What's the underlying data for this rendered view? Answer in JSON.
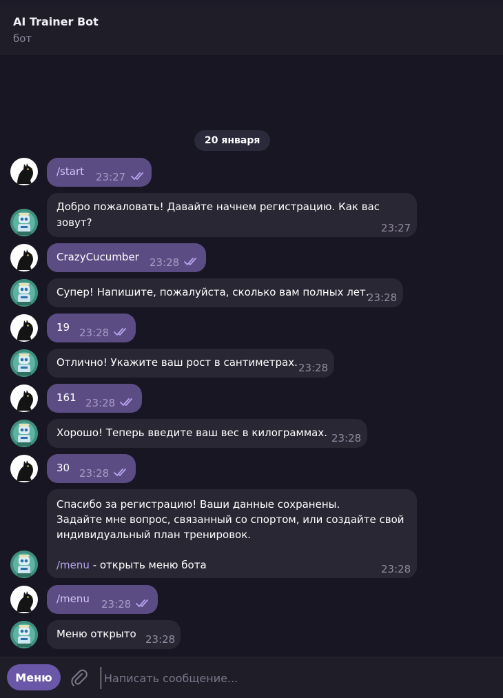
{
  "header": {
    "title": "AI Trainer Bot",
    "subtitle": "бот"
  },
  "date_pill": "20 января",
  "messages": [
    {
      "from": "user",
      "text": "/start",
      "time": "23:27",
      "read": true
    },
    {
      "from": "bot",
      "line1": "Добро пожаловать! Давайте начнем регистрацию. Как вас",
      "line2": "зовут?",
      "time": "23:27"
    },
    {
      "from": "user",
      "text": "CrazyCucumber",
      "time": "23:28",
      "read": true
    },
    {
      "from": "bot",
      "text": "Супер! Напишите, пожалуйста, сколько вам полных лет.",
      "time": "23:28"
    },
    {
      "from": "user",
      "text": "19",
      "time": "23:28",
      "read": true
    },
    {
      "from": "bot",
      "text": "Отлично! Укажите ваш рост в сантиметрах.",
      "time": "23:28"
    },
    {
      "from": "user",
      "text": "161",
      "time": "23:28",
      "read": true
    },
    {
      "from": "bot",
      "text": "Хорошо! Теперь введите ваш вес в килограммах.",
      "time": "23:28"
    },
    {
      "from": "user",
      "text": "30",
      "time": "23:28",
      "read": true
    },
    {
      "from": "bot",
      "line1": "Спасибо за регистрацию! Ваши данные сохранены.",
      "line2": "Задайте мне вопрос, связанный со спортом, или создайте свой",
      "line3": "индивидуальный план тренировок.",
      "cmd": "/menu",
      "cmd_rest": " - открыть меню бота",
      "time": "23:28"
    },
    {
      "from": "user",
      "text": "/menu",
      "time": "23:28",
      "read": true
    },
    {
      "from": "bot",
      "text": "Меню открыто",
      "time": "23:28"
    }
  ],
  "composer": {
    "menu_label": "Меню",
    "placeholder": "Написать сообщение..."
  },
  "colors": {
    "background": "#181622",
    "outgoing_bubble": "#5c4c84",
    "incoming_bubble": "#2a2734",
    "accent": "#6a57a8"
  },
  "icons": {
    "attach": "paperclip-icon",
    "read_status": "double-check-icon",
    "user_avatar": "crow-avatar",
    "bot_avatar": "robot-avatar"
  }
}
